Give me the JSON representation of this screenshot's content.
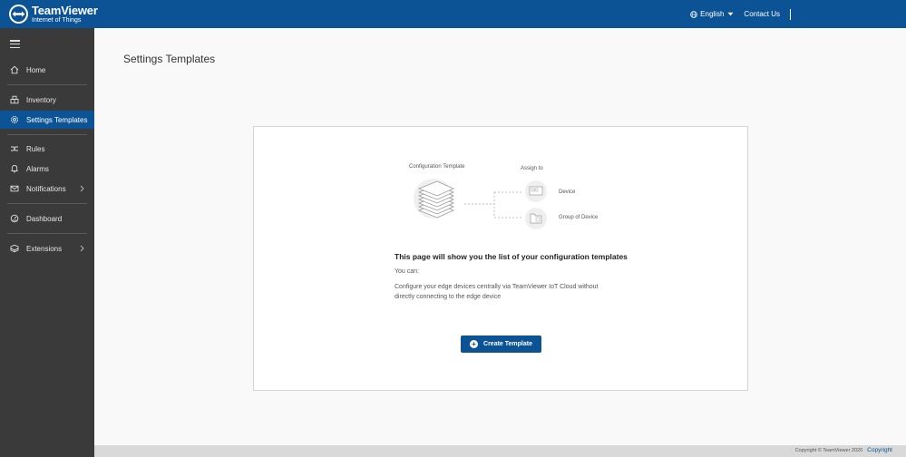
{
  "brand": {
    "name": "TeamViewer",
    "subtitle": "Internet of Things"
  },
  "header": {
    "language": "English",
    "contact": "Contact Us"
  },
  "sidebar": {
    "items": [
      {
        "label": "Home",
        "icon": "home-icon"
      },
      {
        "label": "Inventory",
        "icon": "inventory-icon"
      },
      {
        "label": "Settings Templates",
        "icon": "settings-icon",
        "active": true
      },
      {
        "label": "Rules",
        "icon": "rules-icon"
      },
      {
        "label": "Alarms",
        "icon": "bell-icon"
      },
      {
        "label": "Notifications",
        "icon": "mail-icon",
        "expandable": true
      },
      {
        "label": "Dashboard",
        "icon": "dashboard-icon"
      },
      {
        "label": "Extensions",
        "icon": "extensions-icon",
        "expandable": true
      }
    ]
  },
  "main": {
    "title": "Settings Templates",
    "diagram": {
      "config_label": "Configuration Template",
      "assign_label": "Assign to",
      "device_label": "Device",
      "group_label": "Group of Device"
    },
    "heading": "This page will show you the list of your configuration templates",
    "you_can": "You can:",
    "description": "Configure your edge devices centrally via TeamViewer IoT Cloud without directly connecting to the edge device",
    "create_button": "Create Template"
  },
  "footer": {
    "copyright_text": "Copyright © TeamViewer 2020",
    "copyright_link": "Copyright"
  },
  "colors": {
    "brand_blue": "#0b5394",
    "sidebar_bg": "#3a3a3a"
  }
}
